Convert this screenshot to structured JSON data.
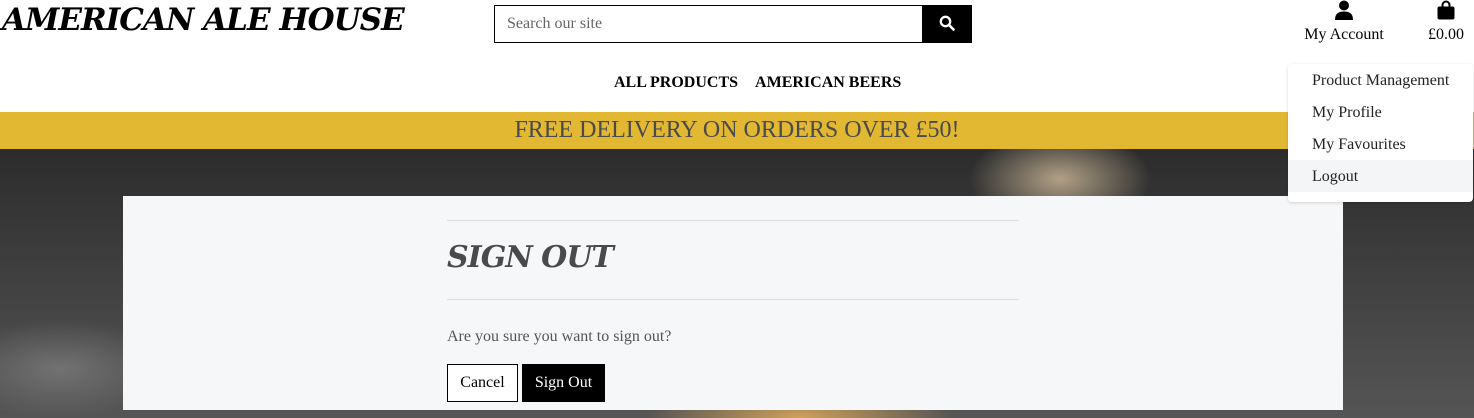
{
  "header": {
    "logo": "AMERICAN ALE HOUSE",
    "search": {
      "placeholder": "Search our site",
      "value": ""
    },
    "account_label": "My Account",
    "bag_total": "£0.00"
  },
  "nav": {
    "items": [
      "ALL PRODUCTS",
      "AMERICAN BEERS"
    ]
  },
  "banner": {
    "text": "FREE DELIVERY ON ORDERS OVER £50!"
  },
  "account_menu": {
    "items": [
      "Product Management",
      "My Profile",
      "My Favourites",
      "Logout"
    ],
    "highlighted": "Logout"
  },
  "main": {
    "title": "SIGN OUT",
    "prompt": "Are you sure you want to sign out?",
    "cancel_label": "Cancel",
    "signout_label": "Sign Out"
  },
  "colors": {
    "banner": "#e2b833",
    "primary_button": "#000000",
    "card_background": "#f6f7f9"
  }
}
